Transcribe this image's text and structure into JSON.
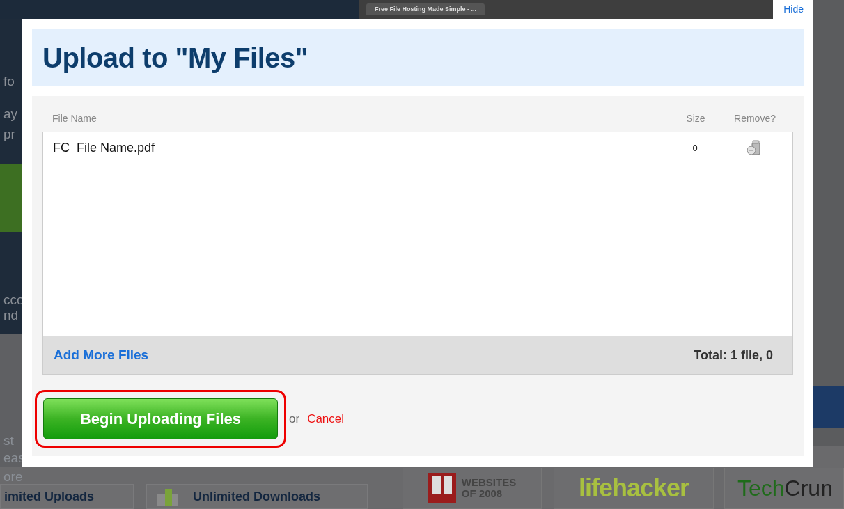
{
  "background": {
    "browser_tab": "Free File Hosting Made Simple - ...",
    "left_fragments": [
      "fo",
      "ay",
      "pr",
      "cco",
      "nd",
      "st",
      "eas",
      "ore"
    ],
    "features": [
      "imited Uploads",
      "Unlimited Downloads"
    ],
    "press": [
      {
        "kind": "pcmag",
        "parts": [
          "WEBSITES",
          "OF 2008"
        ]
      },
      {
        "kind": "lifehacker",
        "parts": [
          "lifehacker"
        ]
      },
      {
        "kind": "techcrunch",
        "parts": [
          "Tech",
          "Crun"
        ]
      }
    ]
  },
  "dialog": {
    "hide": "Hide",
    "title": "Upload to \"My Files\"",
    "columns": [
      "File Name",
      "Size",
      "Remove?"
    ],
    "files": [
      {
        "name": "FC  File Name.pdf",
        "size": "0"
      }
    ],
    "add_more": "Add More Files",
    "total": "Total: 1 file, 0",
    "begin_button": {
      "label": "Begin Uploading Files",
      "highlighted": true
    },
    "or": "or",
    "cancel": "Cancel"
  }
}
